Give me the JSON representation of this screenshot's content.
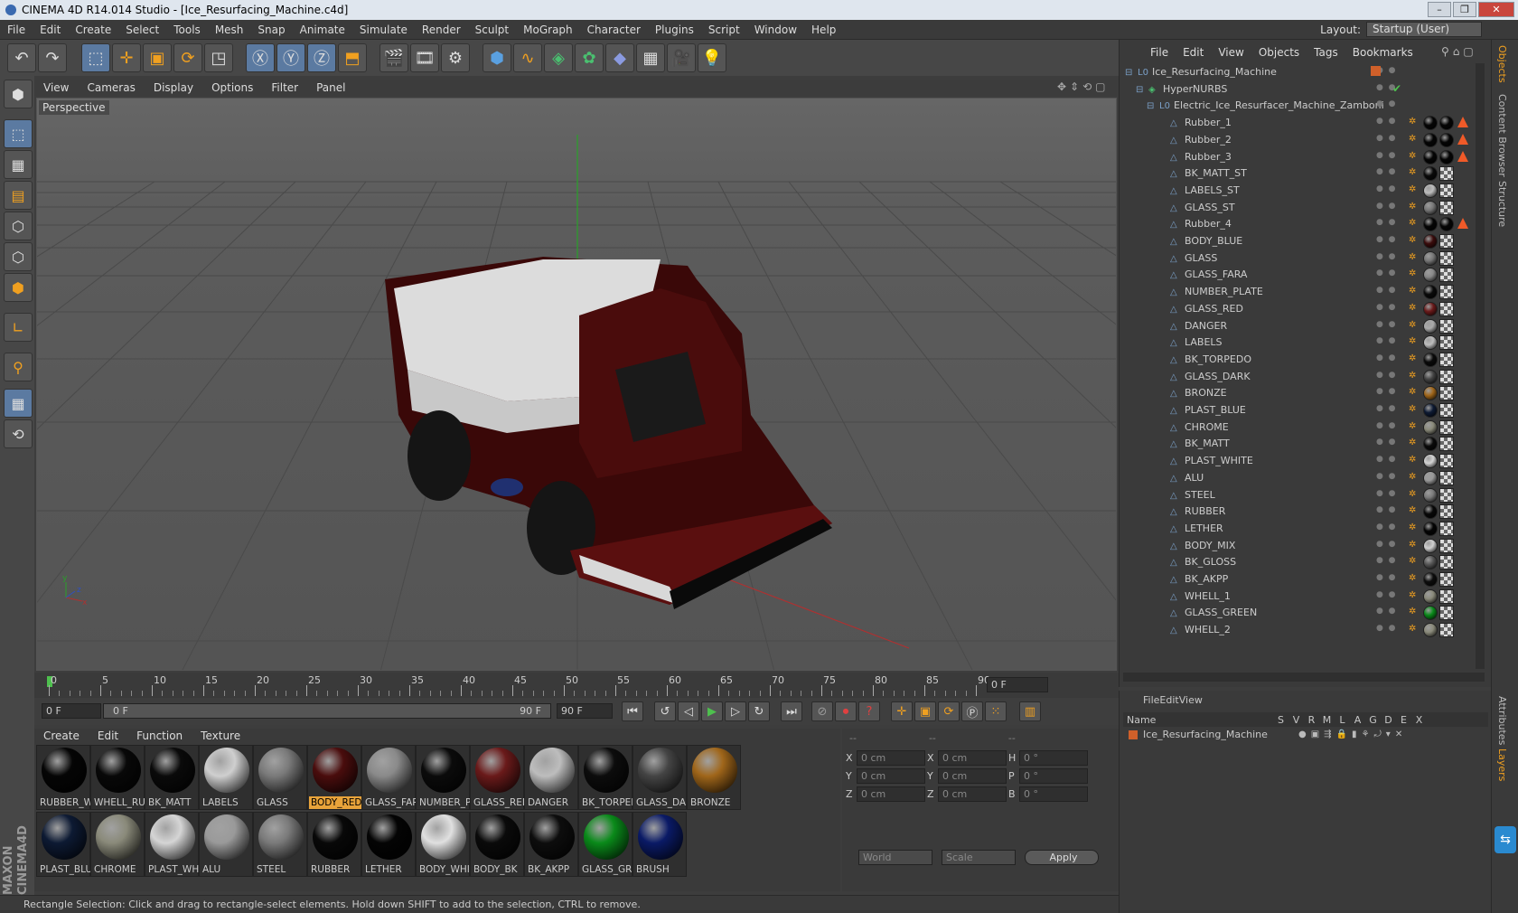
{
  "window": {
    "title": "CINEMA 4D R14.014 Studio - [Ice_Resurfacing_Machine.c4d]"
  },
  "menubar": [
    "File",
    "Edit",
    "Create",
    "Select",
    "Tools",
    "Mesh",
    "Snap",
    "Animate",
    "Simulate",
    "Render",
    "Sculpt",
    "MoGraph",
    "Character",
    "Plugins",
    "Script",
    "Window",
    "Help"
  ],
  "layout": {
    "label": "Layout:",
    "value": "Startup (User)"
  },
  "viewport": {
    "menu": [
      "View",
      "Cameras",
      "Display",
      "Options",
      "Filter",
      "Panel"
    ],
    "label": "Perspective"
  },
  "timeline": {
    "ticks": [
      "0",
      "5",
      "10",
      "15",
      "20",
      "25",
      "30",
      "35",
      "40",
      "45",
      "50",
      "55",
      "60",
      "65",
      "70",
      "75",
      "80",
      "85",
      "90"
    ],
    "end_frame": "0 F",
    "current": "0 F",
    "range_start": "0 F",
    "range_end": "90 F",
    "max": "90 F"
  },
  "materials": {
    "menu": [
      "Create",
      "Edit",
      "Function",
      "Texture"
    ],
    "items": [
      {
        "label": "RUBBER_W",
        "color": "#050505",
        "selected": false
      },
      {
        "label": "WHELL_RU",
        "color": "#080808",
        "selected": false
      },
      {
        "label": "BK_MATT",
        "color": "#0a0a0a",
        "selected": false
      },
      {
        "label": "LABELS",
        "color": "#cfcfcf",
        "selected": false
      },
      {
        "label": "GLASS",
        "color": "#7a7a7a",
        "selected": false
      },
      {
        "label": "BODY_RED",
        "color": "#4a0d0d",
        "selected": true
      },
      {
        "label": "GLASS_FAR",
        "color": "#8a8a8a",
        "selected": false
      },
      {
        "label": "NUMBER_P",
        "color": "#0b0b0b",
        "selected": false
      },
      {
        "label": "GLASS_RED",
        "color": "#6a1a1a",
        "selected": false
      },
      {
        "label": "DANGER",
        "color": "#bdbdbd",
        "selected": false
      },
      {
        "label": "BK_TORPED",
        "color": "#0c0c0c",
        "selected": false
      },
      {
        "label": "GLASS_DAF",
        "color": "#444444",
        "selected": false
      },
      {
        "label": "BRONZE",
        "color": "#a0661a",
        "selected": false
      },
      {
        "label": "PLAST_BLUI",
        "color": "#0d1a33",
        "selected": false
      },
      {
        "label": "CHROME",
        "color": "#8a8a7a",
        "selected": false
      },
      {
        "label": "PLAST_WHI",
        "color": "#d5d5d5",
        "selected": false
      },
      {
        "label": "ALU",
        "color": "#9a9a9a",
        "selected": false
      },
      {
        "label": "STEEL",
        "color": "#7a7a7a",
        "selected": false
      },
      {
        "label": "RUBBER",
        "color": "#080808",
        "selected": false
      },
      {
        "label": "LETHER",
        "color": "#040404",
        "selected": false
      },
      {
        "label": "BODY_WHI",
        "color": "#e0e0e0",
        "selected": false
      },
      {
        "label": "BODY_BK",
        "color": "#0a0a0a",
        "selected": false
      },
      {
        "label": "BK_AKPP",
        "color": "#0d0d0d",
        "selected": false
      },
      {
        "label": "GLASS_GRE",
        "color": "#0a8a1a",
        "selected": false
      },
      {
        "label": "BRUSH",
        "color": "#0a1a66",
        "selected": false
      }
    ]
  },
  "coords": {
    "header": [
      "--",
      "--",
      "--"
    ],
    "rows": [
      {
        "a": "X",
        "av": "0 cm",
        "b": "X",
        "bv": "0 cm",
        "c": "H",
        "cv": "0 °"
      },
      {
        "a": "Y",
        "av": "0 cm",
        "b": "Y",
        "bv": "0 cm",
        "c": "P",
        "cv": "0 °"
      },
      {
        "a": "Z",
        "av": "0 cm",
        "b": "Z",
        "bv": "0 cm",
        "c": "B",
        "cv": "0 °"
      }
    ],
    "world": "World",
    "scale": "Scale",
    "apply": "Apply"
  },
  "status": "Rectangle Selection: Click and drag to rectangle-select elements. Hold down SHIFT to add to the selection, CTRL to remove.",
  "objects": {
    "menu": [
      "File",
      "Edit",
      "View",
      "Objects",
      "Tags",
      "Bookmarks"
    ],
    "tree": [
      {
        "name": "Ice_Resurfacing_Machine",
        "level": 0
      },
      {
        "name": "HyperNURBS",
        "level": 1
      },
      {
        "name": "Electric_Ice_Resurfacer_Machine_Zamboni",
        "level": 2
      },
      {
        "name": "Rubber_1",
        "level": 3,
        "tag": "#050505",
        "warn": true
      },
      {
        "name": "Rubber_2",
        "level": 3,
        "tag": "#050505",
        "warn": true
      },
      {
        "name": "Rubber_3",
        "level": 3,
        "tag": "#050505",
        "warn": true
      },
      {
        "name": "BK_MATT_ST",
        "level": 3,
        "tag": "#0a0a0a"
      },
      {
        "name": "LABELS_ST",
        "level": 3,
        "tag": "#bdbdbd"
      },
      {
        "name": "GLASS_ST",
        "level": 3,
        "tag": "#777777"
      },
      {
        "name": "Rubber_4",
        "level": 3,
        "tag": "#050505",
        "warn": true
      },
      {
        "name": "BODY_BLUE",
        "level": 3,
        "tag": "#3a0b0b"
      },
      {
        "name": "GLASS",
        "level": 3,
        "tag": "#777777"
      },
      {
        "name": "GLASS_FARA",
        "level": 3,
        "tag": "#888888"
      },
      {
        "name": "NUMBER_PLATE",
        "level": 3,
        "tag": "#0a0a0a"
      },
      {
        "name": "GLASS_RED",
        "level": 3,
        "tag": "#6a1a1a"
      },
      {
        "name": "DANGER",
        "level": 3,
        "tag": "#aaaaaa"
      },
      {
        "name": "LABELS",
        "level": 3,
        "tag": "#bdbdbd"
      },
      {
        "name": "BK_TORPEDO",
        "level": 3,
        "tag": "#0a0a0a"
      },
      {
        "name": "GLASS_DARK",
        "level": 3,
        "tag": "#444444"
      },
      {
        "name": "BRONZE",
        "level": 3,
        "tag": "#a0661a"
      },
      {
        "name": "PLAST_BLUE",
        "level": 3,
        "tag": "#0d1a33"
      },
      {
        "name": "CHROME",
        "level": 3,
        "tag": "#8a8a7a"
      },
      {
        "name": "BK_MATT",
        "level": 3,
        "tag": "#0a0a0a"
      },
      {
        "name": "PLAST_WHITE",
        "level": 3,
        "tag": "#d5d5d5"
      },
      {
        "name": "ALU",
        "level": 3,
        "tag": "#9a9a9a"
      },
      {
        "name": "STEEL",
        "level": 3,
        "tag": "#7a7a7a"
      },
      {
        "name": "RUBBER",
        "level": 3,
        "tag": "#080808"
      },
      {
        "name": "LETHER",
        "level": 3,
        "tag": "#040404"
      },
      {
        "name": "BODY_MIX",
        "level": 3,
        "tag": "#d0d0d0"
      },
      {
        "name": "BK_GLOSS",
        "level": 3,
        "tag": "#555555"
      },
      {
        "name": "BK_AKPP",
        "level": 3,
        "tag": "#0d0d0d"
      },
      {
        "name": "WHELL_1",
        "level": 3,
        "tag": "#8a8a7a"
      },
      {
        "name": "GLASS_GREEN",
        "level": 3,
        "tag": "#0a8a1a"
      },
      {
        "name": "WHELL_2",
        "level": 3,
        "tag": "#8a8a7a"
      }
    ]
  },
  "attributes": {
    "menu": [
      "File",
      "Edit",
      "View"
    ],
    "columns": [
      "Name",
      "S",
      "V",
      "R",
      "M",
      "L",
      "A",
      "G",
      "D",
      "E",
      "X"
    ],
    "rows": [
      "Ice_Resurfacing_Machine"
    ]
  },
  "side_tabs": [
    "Objects",
    "Content Browser",
    "Structure",
    "Attributes",
    "Layers"
  ]
}
